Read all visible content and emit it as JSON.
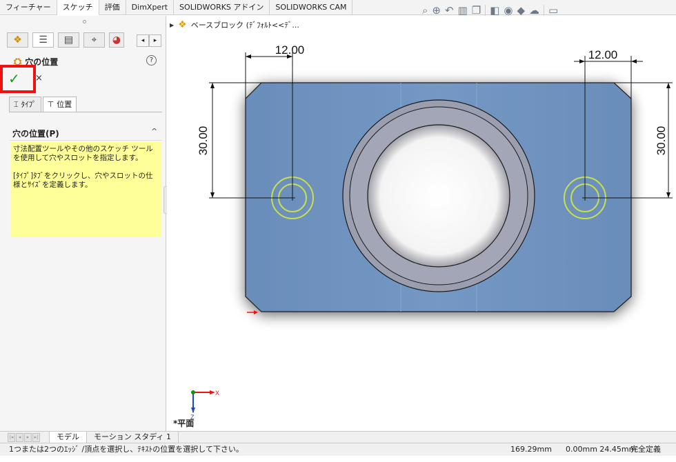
{
  "top_tabs": [
    "フィーチャー",
    "スケッチ",
    "評価",
    "DimXpert",
    "SOLIDWORKS アドイン",
    "SOLIDWORKS CAM"
  ],
  "active_tab_index": 1,
  "hud_icons": [
    "zoom-to-fit-icon",
    "zoom-area-icon",
    "previous-view-icon",
    "section-view-icon",
    "view-orientation-icon",
    "display-style-icon",
    "hide-show-icon",
    "edit-appearance-icon",
    "apply-scene-icon",
    "view-settings-icon"
  ],
  "panel": {
    "title": "穴の位置",
    "help": "?",
    "ok_symbol": "✓",
    "cancel_symbol": "×",
    "tab_type": "ﾀｲﾌﾟ",
    "tab_position": "位置",
    "group_title": "穴の位置(P)",
    "group_caret": "^",
    "note_p1": "寸法配置ツールやその他のスケッチ ツールを使用して穴やスロットを指定します。",
    "note_p2": "[ﾀｲﾌﾟ]ﾀﾌﾞをクリックし、穴やスロットの仕様とｻｲｽﾞを定義します。"
  },
  "tree_item": "ベースブロック (ﾃﾞﾌｫﾙﾄ<<ﾃﾞ...",
  "dimensions": {
    "top_left": "12.00",
    "top_right": "12.00",
    "side_left": "30.00",
    "side_right": "30.00"
  },
  "triad": {
    "y": "Y",
    "x": "X",
    "z": "Z",
    "plane": "*平面"
  },
  "bottom_tabs": [
    "モデル",
    "モーション スタディ 1"
  ],
  "status": {
    "message": "1つまたは2つのｴｯｼﾞ /頂点を選択し、ﾃｷｽﾄの位置を選択して下さい。",
    "value1": "169.29mm",
    "value2": "0.00mm 24.45mm",
    "value3": "完全定義"
  },
  "colors": {
    "face": "#6b8fba",
    "boss": "#9a9eaf",
    "hole_marker": "#c8e050",
    "highlight": "#e11111"
  }
}
